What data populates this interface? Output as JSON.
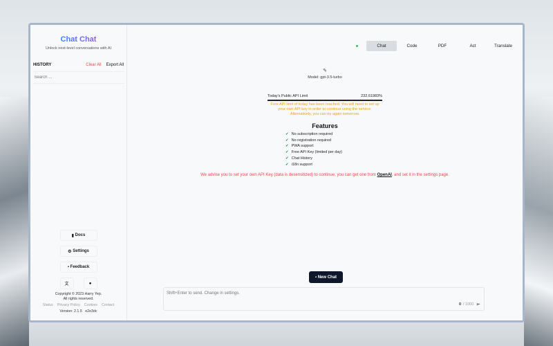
{
  "app": {
    "title": "Chat Chat",
    "tagline": "Unlock next-level conversations with AI"
  },
  "history": {
    "label": "HISTORY",
    "clear": "Clear All",
    "export": "Export All",
    "search_placeholder": "Search ..."
  },
  "sidebar": {
    "docs": "Docs",
    "settings": "Settings",
    "feedback": "Feedback",
    "copyright": "Copyright © 2023 Harry Yep.",
    "rights": "All rights reserved.",
    "links": [
      "Status",
      "Privacy Policy",
      "Cookies",
      "Contact"
    ],
    "version": "Version: 2.1.5   e2e3dc"
  },
  "tabs": [
    "Chat",
    "Code",
    "PDF",
    "Act",
    "Translate"
  ],
  "main": {
    "model": "Model: gpt-3.5-turbo",
    "limit_label": "Today's Public API Limit",
    "limit_value": "232.61983%",
    "warning": "Free API limit of today has been reached. You will need to set up your own API key in order to continue using the service. Alternatively, you can try again tomorrow.",
    "features_title": "Features",
    "features": [
      "No subscription required",
      "No registration required",
      "PWA support",
      "Free API Key (limited per day)",
      "Chat History",
      "i18n support"
    ],
    "advise_pre": "We advise you to set your own API Key (data is desensitized) to continue, you can get one from ",
    "advise_link": "OpenAI",
    "advise_post": ", and set it in the settings page."
  },
  "composer": {
    "new_chat": "New Chat",
    "placeholder": "Shift+Enter to send. Change in settings.",
    "count": "0",
    "max": "/ 1000"
  },
  "colors": {
    "accent": "#0f172a",
    "warning": "#f59e0b",
    "error": "#ef4444",
    "status": "#22c55e"
  }
}
